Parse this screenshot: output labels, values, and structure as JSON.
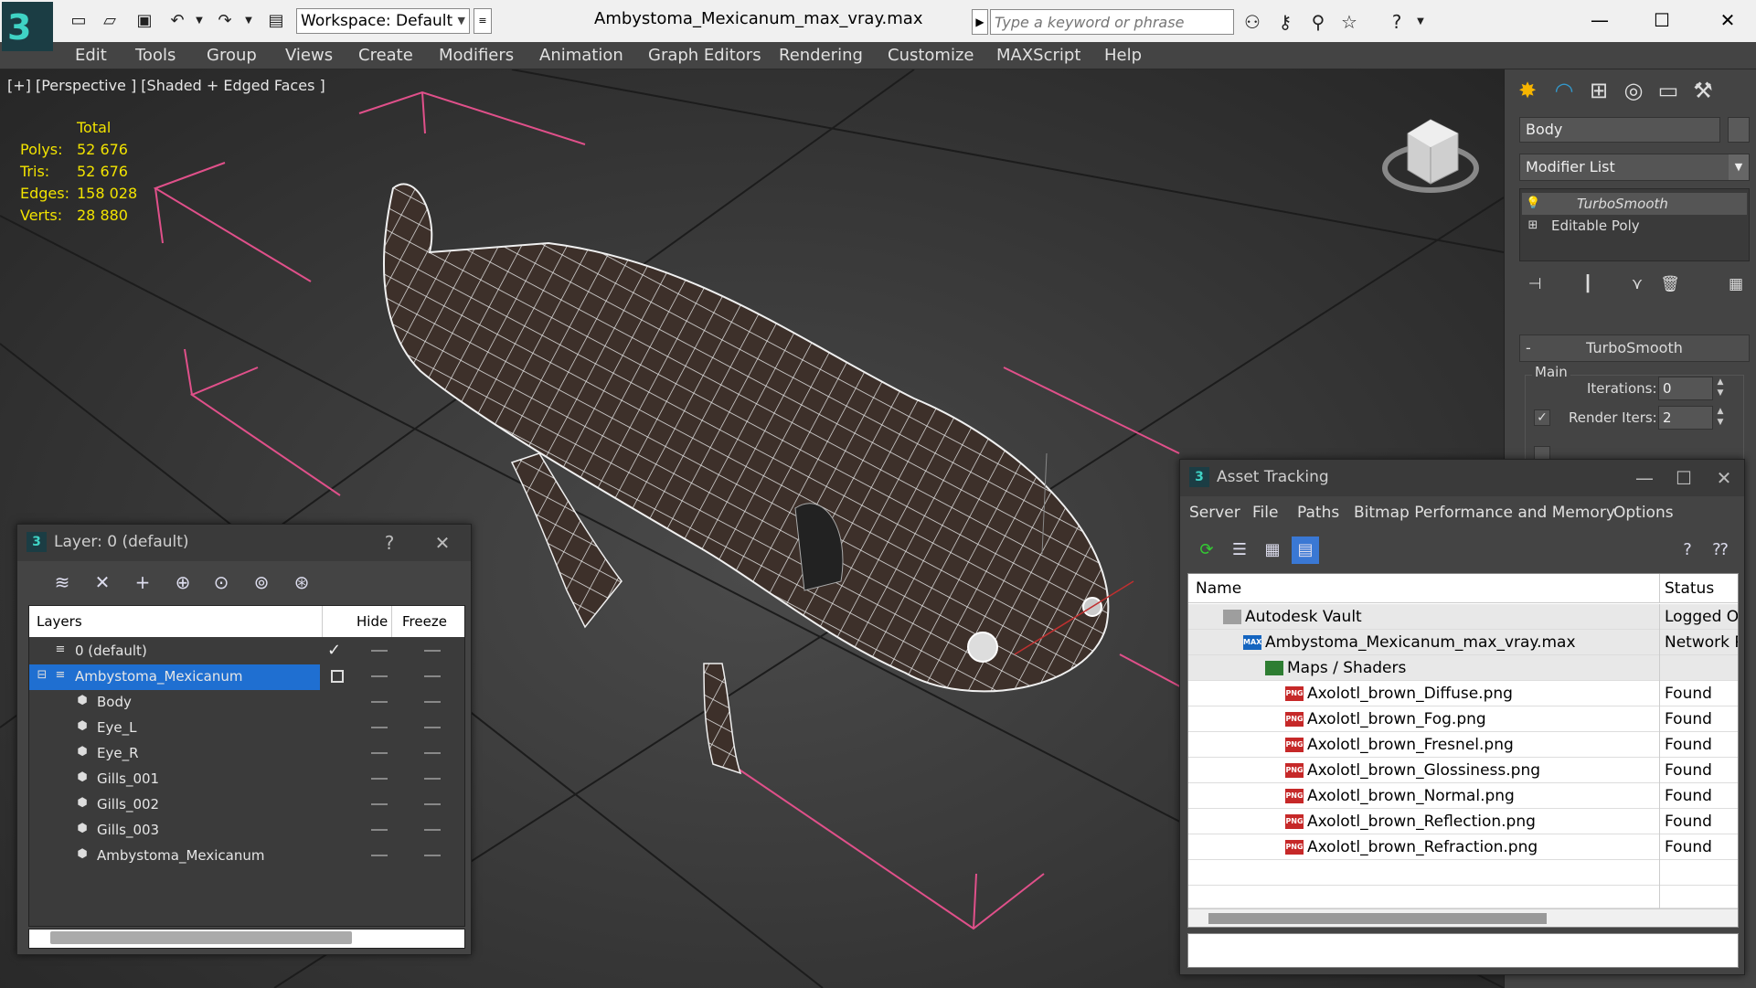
{
  "titlebar": {
    "workspace_label": "Workspace: Default",
    "document_title": "Ambystoma_Mexicanum_max_vray.max",
    "search_placeholder": "Type a keyword or phrase"
  },
  "menu": [
    "Edit",
    "Tools",
    "Group",
    "Views",
    "Create",
    "Modifiers",
    "Animation",
    "Graph Editors",
    "Rendering",
    "Customize",
    "MAXScript",
    "Help"
  ],
  "viewport": {
    "label": "[+] [Perspective ] [Shaded + Edged Faces ]",
    "stats": {
      "header": "Total",
      "rows": [
        {
          "label": "Polys:",
          "value": "52 676"
        },
        {
          "label": "Tris:",
          "value": "52 676"
        },
        {
          "label": "Edges:",
          "value": "158 028"
        },
        {
          "label": "Verts:",
          "value": "28 880"
        }
      ]
    }
  },
  "command_panel": {
    "object_name": "Body",
    "modifier_list_label": "Modifier List",
    "stack": [
      "TurboSmooth",
      "Editable Poly"
    ],
    "rollout_title": "TurboSmooth",
    "main_label": "Main",
    "iterations_label": "Iterations:",
    "iterations_value": "0",
    "render_iters_label": "Render Iters:",
    "render_iters_value": "2"
  },
  "layer_dialog": {
    "title": "Layer: 0 (default)",
    "help": "?",
    "columns": {
      "layers": "Layers",
      "hide": "Hide",
      "freeze": "Freeze"
    },
    "rows": [
      {
        "name": "0 (default)",
        "level": 0,
        "kind": "layer",
        "current": true
      },
      {
        "name": "Ambystoma_Mexicanum",
        "level": 0,
        "kind": "layer",
        "selected": true
      },
      {
        "name": "Body",
        "level": 1,
        "kind": "object"
      },
      {
        "name": "Eye_L",
        "level": 1,
        "kind": "object"
      },
      {
        "name": "Eye_R",
        "level": 1,
        "kind": "object"
      },
      {
        "name": "Gills_001",
        "level": 1,
        "kind": "object"
      },
      {
        "name": "Gills_002",
        "level": 1,
        "kind": "object"
      },
      {
        "name": "Gills_003",
        "level": 1,
        "kind": "object"
      },
      {
        "name": "Ambystoma_Mexicanum",
        "level": 1,
        "kind": "object"
      }
    ]
  },
  "asset_dialog": {
    "title": "Asset Tracking",
    "menu": [
      "Server",
      "File",
      "Paths",
      "Bitmap Performance and Memory",
      "Options"
    ],
    "columns": {
      "name": "Name",
      "status": "Status"
    },
    "rows": [
      {
        "name": "Autodesk Vault",
        "status": "Logged Ou",
        "icon": "vault",
        "indent": 1
      },
      {
        "name": "Ambystoma_Mexicanum_max_vray.max",
        "status": "Network Pa",
        "icon": "max",
        "indent": 2
      },
      {
        "name": "Maps / Shaders",
        "status": "",
        "icon": "maps",
        "indent": 3
      },
      {
        "name": "Axolotl_brown_Diffuse.png",
        "status": "Found",
        "icon": "png",
        "indent": 4
      },
      {
        "name": "Axolotl_brown_Fog.png",
        "status": "Found",
        "icon": "png",
        "indent": 4
      },
      {
        "name": "Axolotl_brown_Fresnel.png",
        "status": "Found",
        "icon": "png",
        "indent": 4
      },
      {
        "name": "Axolotl_brown_Glossiness.png",
        "status": "Found",
        "icon": "png",
        "indent": 4
      },
      {
        "name": "Axolotl_brown_Normal.png",
        "status": "Found",
        "icon": "png",
        "indent": 4
      },
      {
        "name": "Axolotl_brown_Reflection.png",
        "status": "Found",
        "icon": "png",
        "indent": 4
      },
      {
        "name": "Axolotl_brown_Refraction.png",
        "status": "Found",
        "icon": "png",
        "indent": 4
      }
    ]
  },
  "colors": {
    "stats_yellow": "#f2e300",
    "selection_blue": "#1f6fd1",
    "bbox_pink": "#e0508a"
  }
}
